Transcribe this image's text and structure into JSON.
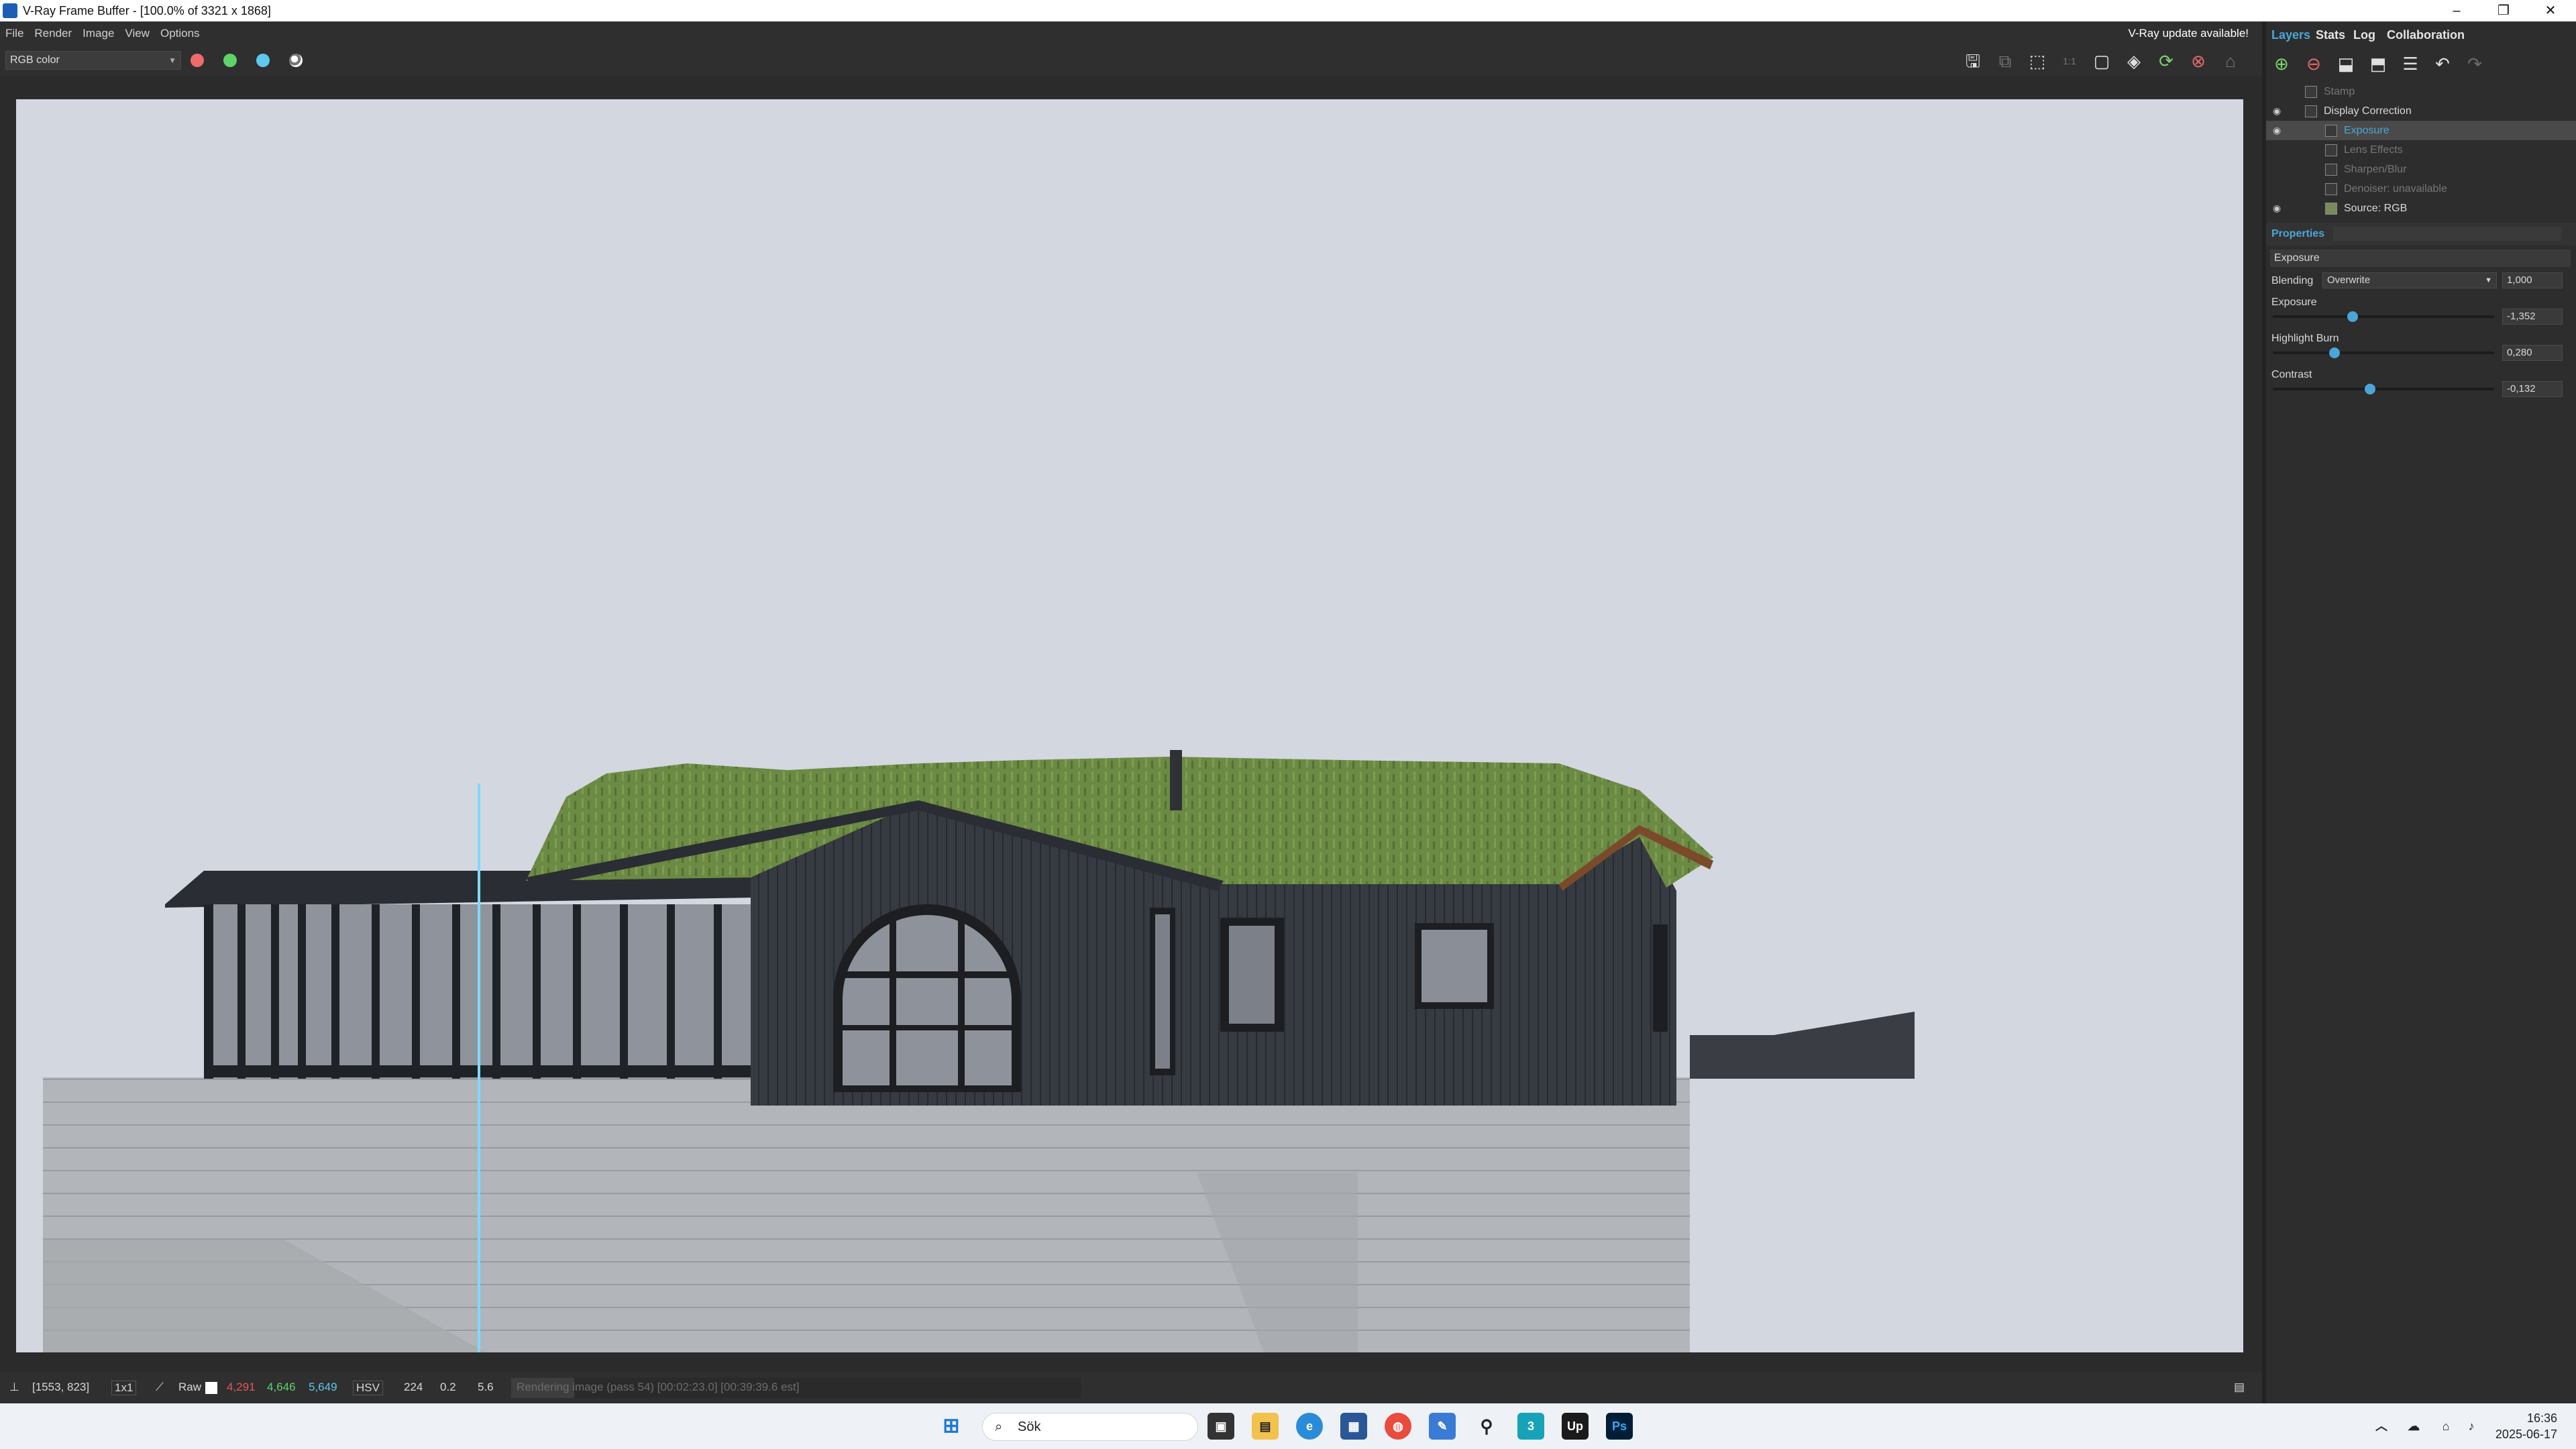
{
  "window": {
    "title": "V-Ray Frame Buffer - [100.0% of 3321 x 1868]"
  },
  "menu": {
    "items": [
      "File",
      "Render",
      "Image",
      "View",
      "Options"
    ],
    "update_notice": "V-Ray update available!"
  },
  "toolbar": {
    "channel": "RGB color"
  },
  "tabs": [
    "Layers",
    "Stats",
    "Log",
    "Collaboration"
  ],
  "layers": [
    {
      "name": "Stamp",
      "visible": false
    },
    {
      "name": "Display Correction",
      "visible": true
    },
    {
      "name": "Exposure",
      "visible": true,
      "selected": true
    },
    {
      "name": "Lens Effects",
      "visible": false
    },
    {
      "name": "Sharpen/Blur",
      "visible": false
    },
    {
      "name": "Denoiser: unavailable",
      "visible": false
    },
    {
      "name": "Source: RGB",
      "visible": true
    }
  ],
  "properties": {
    "header": "Properties",
    "layer_name": "Exposure",
    "blending_label": "Blending",
    "blending_mode": "Overwrite",
    "blending_value": "1,000",
    "sliders": [
      {
        "label": "Exposure",
        "value": "-1,352",
        "fraction": 0.36
      },
      {
        "label": "Highlight Burn",
        "value": "0,280",
        "fraction": 0.28
      },
      {
        "label": "Contrast",
        "value": "-0,132",
        "fraction": 0.44
      }
    ]
  },
  "status": {
    "coords": "[1553, 823]",
    "zoom": "1x1",
    "mode": "Raw",
    "r": "4,291",
    "g": "4,646",
    "b": "5,649",
    "colorspace": "HSV",
    "h": "224",
    "s": "0.2",
    "v": "5.6",
    "progress_text": "Rendering image (pass 54) [00:02:23.0] [00:39:39.6 est]",
    "progress": 0.11
  },
  "taskbar": {
    "search_placeholder": "Sök",
    "time": "16:36",
    "date": "2025-06-17"
  },
  "colors": {
    "accent": "#4aa6d8",
    "red_dot": "#ef6b6b",
    "green_dot": "#5ed36a",
    "blue_dot": "#5ec8ef"
  }
}
